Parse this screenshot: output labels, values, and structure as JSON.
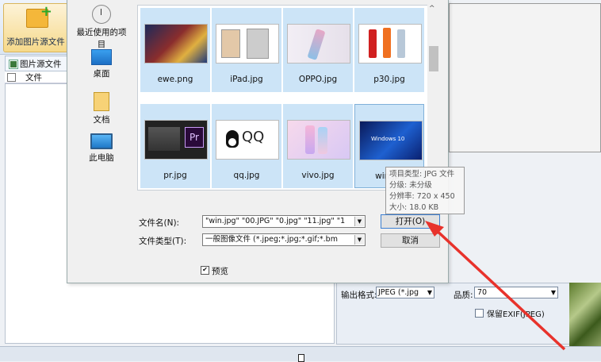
{
  "app": {
    "add_button": "添加图片源文件",
    "source_tab": "图片源文件",
    "file_column": "文件",
    "output_format_label": "输出格式:",
    "output_format_value": "JPEG (*.jpg",
    "quality_label": "品质:",
    "quality_value": "70",
    "keep_exif_label": "保留EXIF(JPEG)"
  },
  "dialog": {
    "places": [
      {
        "label": "最近使用的项目",
        "icon": "recent-icon"
      },
      {
        "label": "桌面",
        "icon": "desktop-icon"
      },
      {
        "label": "文档",
        "icon": "documents-icon"
      },
      {
        "label": "此电脑",
        "icon": "computer-icon"
      }
    ],
    "files": [
      {
        "name": "ewe.png"
      },
      {
        "name": "iPad.jpg"
      },
      {
        "name": "OPPO.jpg"
      },
      {
        "name": "p30.jpg"
      },
      {
        "name": "pr.jpg"
      },
      {
        "name": "qq.jpg"
      },
      {
        "name": "vivo.jpg"
      },
      {
        "name": "win.jpg"
      }
    ],
    "filename_label": "文件名(N):",
    "filename_value": "\"win.jpg\" \"00.JPG\" \"0.jpg\" \"11.jpg\" \"1",
    "filetype_label": "文件类型(T):",
    "filetype_value": "一般图像文件 (*.jpeg;*.jpg;*.gif;*.bm",
    "open_button": "打开(O)",
    "cancel_button": "取消",
    "preview_label": "预览",
    "preview_checked": "✔"
  },
  "tooltip": {
    "type": "项目类型: JPG 文件",
    "rating": "分级: 未分级",
    "resolution": "分辨率: 720 x 450",
    "size": "大小: 18.0 KB"
  },
  "thumbs": {
    "qq_text": "QQ",
    "pr_text": "Pr",
    "win_text": "Windows 10"
  },
  "colors": {
    "selection": "#cce4f7",
    "arrow": "#e8322b",
    "accent_button_border": "#3b7ed1"
  }
}
